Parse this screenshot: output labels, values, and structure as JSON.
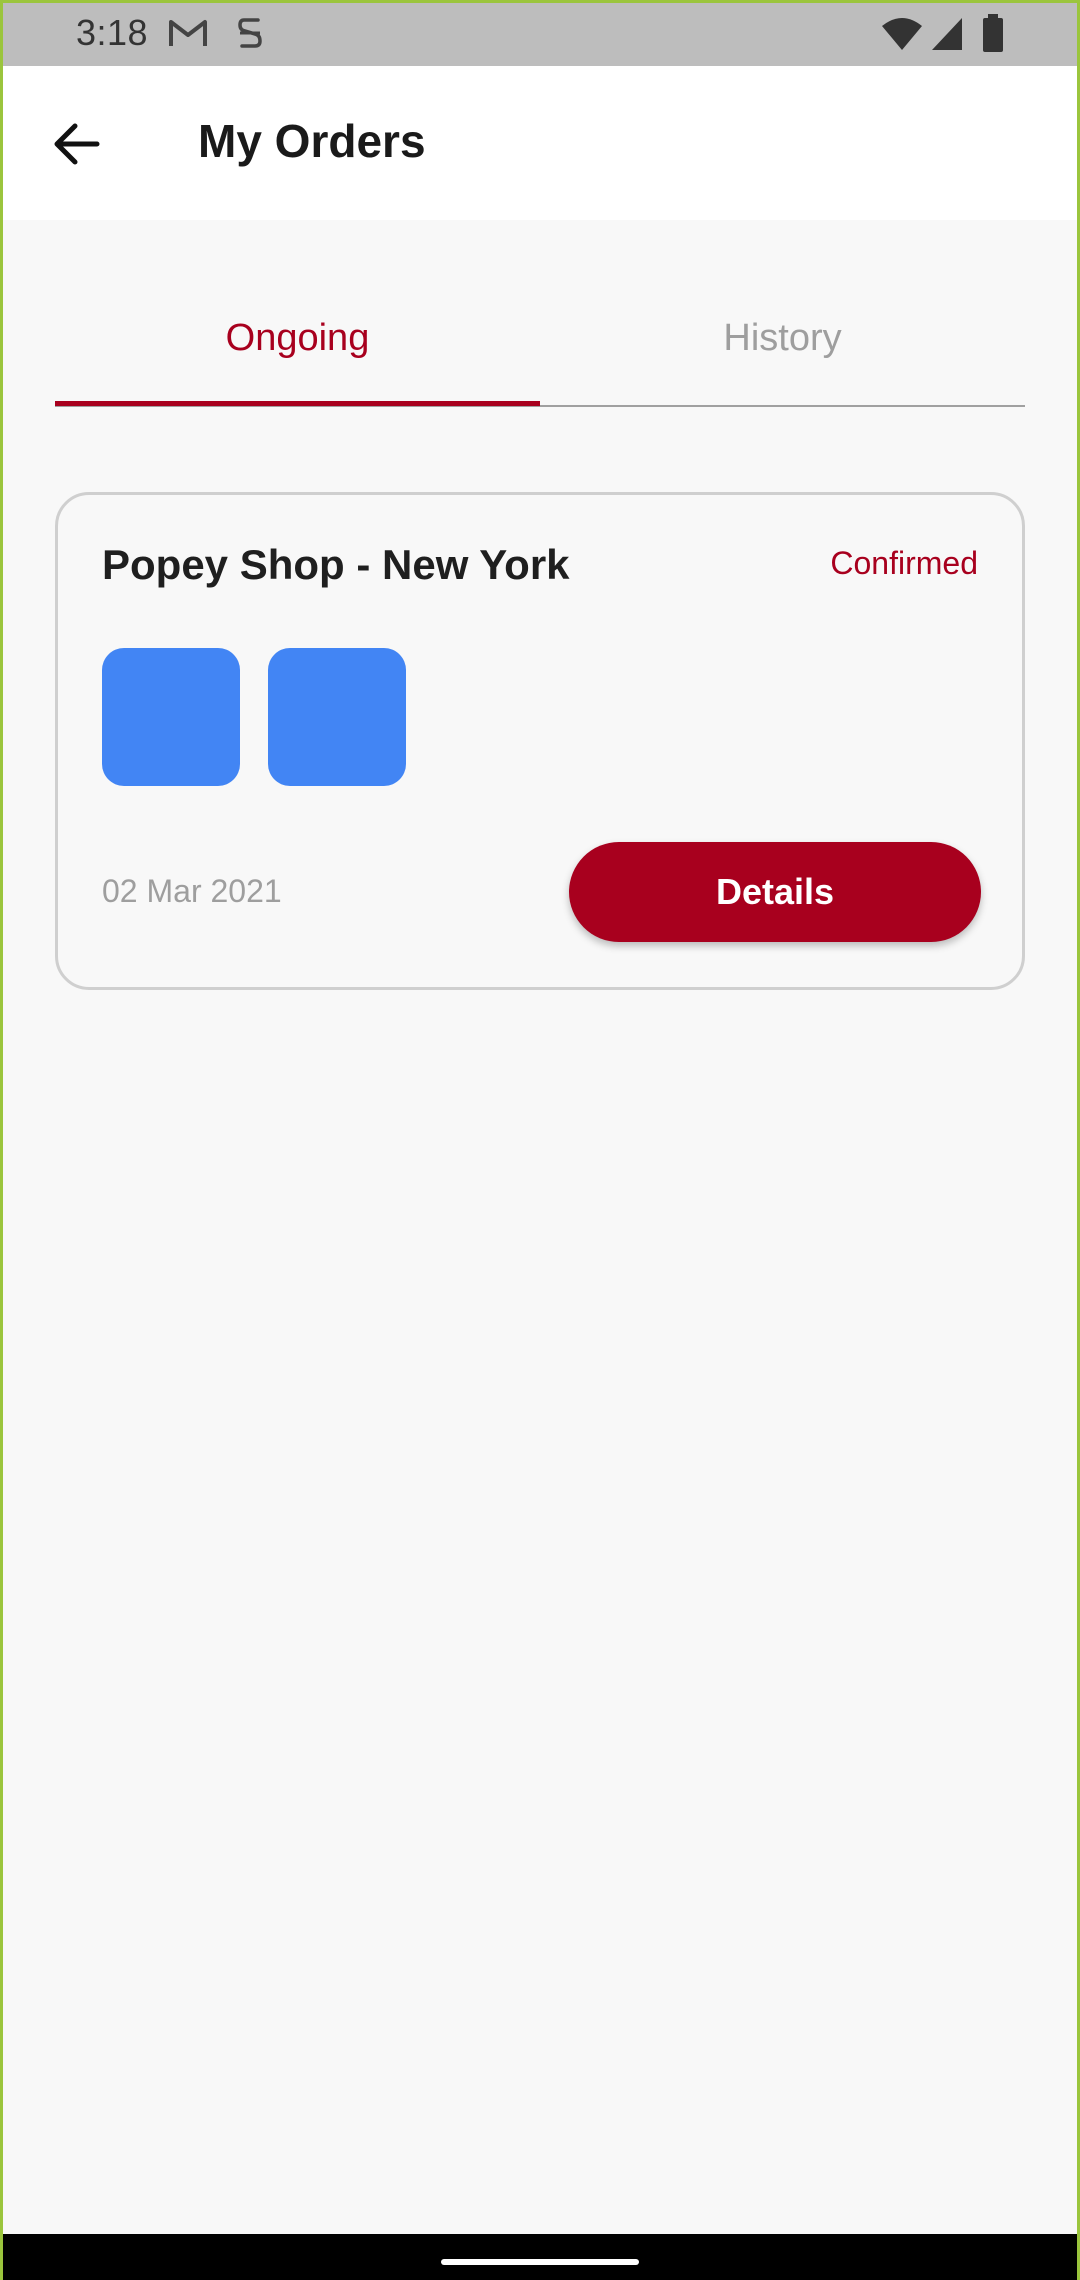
{
  "status_bar": {
    "time": "3:18",
    "icons": [
      "gmail-icon",
      "s-icon",
      "wifi-icon",
      "signal-icon",
      "battery-icon"
    ]
  },
  "header": {
    "back_icon": "arrow-left-icon",
    "title": "My Orders"
  },
  "tabs": [
    {
      "label": "Ongoing",
      "selected": true
    },
    {
      "label": "History",
      "selected": false
    }
  ],
  "orders": [
    {
      "shop": "Popey Shop - New York",
      "status": "Confirmed",
      "date": "02 Mar 2021",
      "details_label": "Details",
      "thumbnail_count": 2
    }
  ],
  "colors": {
    "accent": "#a8001e",
    "thumbnail": "#4285f4",
    "background": "#f8f8f8",
    "muted_text": "#9e9e9e"
  }
}
